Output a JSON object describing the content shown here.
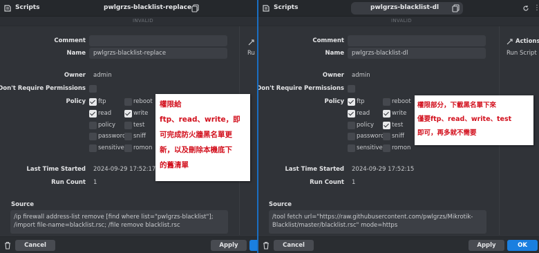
{
  "left": {
    "app_name": "Scripts",
    "title": "pwlgrzs-blacklist-replace",
    "status": "INVALID",
    "labels": {
      "comment": "Comment",
      "name": "Name",
      "owner": "Owner",
      "dont_require": "Don't Require Permissions",
      "policy": "Policy",
      "last_time_started": "Last Time Started",
      "run_count": "Run Count",
      "source": "Source"
    },
    "comment": "",
    "name": "pwlgrzs-blacklist-replace",
    "owner": "admin",
    "last_time_started": "2024-09-29 17:52:17",
    "run_count": "1",
    "policies": [
      {
        "label": "ftp",
        "checked": true
      },
      {
        "label": "reboot",
        "checked": false
      },
      {
        "label": "read",
        "checked": true
      },
      {
        "label": "write",
        "checked": true
      },
      {
        "label": "policy",
        "checked": false
      },
      {
        "label": "test",
        "checked": false
      },
      {
        "label": "password",
        "checked": false
      },
      {
        "label": "sniff",
        "checked": false
      },
      {
        "label": "sensitive",
        "checked": false
      },
      {
        "label": "romon",
        "checked": false
      }
    ],
    "source": "/ip firewall address-list remove [find where list=\"pwlgrzs-blacklist\"]; /import file-name=blacklist.rsc; /file remove blacklist.rsc",
    "side_partial": "Ru",
    "cancel": "Cancel",
    "apply": "Apply"
  },
  "right": {
    "app_name": "Scripts",
    "title": "pwlgrzs-blacklist-dl",
    "status": "INVALID",
    "labels": {
      "comment": "Comment",
      "name": "Name",
      "owner": "Owner",
      "dont_require": "Don't Require Permissions",
      "policy": "Policy",
      "last_time_started": "Last Time Started",
      "run_count": "Run Count",
      "source": "Source"
    },
    "comment": "",
    "name": "pwlgrzs-blacklist-dl",
    "owner": "admin",
    "last_time_started": "2024-09-29 17:52:15",
    "run_count": "1",
    "policies": [
      {
        "label": "ftp",
        "checked": true
      },
      {
        "label": "reboot",
        "checked": false
      },
      {
        "label": "read",
        "checked": true
      },
      {
        "label": "write",
        "checked": true
      },
      {
        "label": "policy",
        "checked": false
      },
      {
        "label": "test",
        "checked": true
      },
      {
        "label": "password",
        "checked": false
      },
      {
        "label": "sniff",
        "checked": false
      },
      {
        "label": "sensitive",
        "checked": false
      },
      {
        "label": "romon",
        "checked": false
      }
    ],
    "source": "/tool fetch url=\"https://raw.githubusercontent.com/pwlgrzs/Mikrotik-Blacklist/master/blacklist.rsc\" mode=https",
    "actions_title": "Actions",
    "run_script": "Run Script",
    "cancel": "Cancel",
    "apply": "Apply",
    "ok": "OK"
  },
  "notes": {
    "left": [
      "權限給",
      "ftp、read、write，即",
      "可完成防火牆黑名單更",
      "新，以及刪除本機底下",
      "的舊清單"
    ],
    "right": [
      "權限部分，下載黑名單下來",
      "僅要ftp、read、write、test",
      "即可，再多就不需要"
    ]
  },
  "colors": {
    "accent": "#1a7fe0",
    "note_text": "#d20f1c",
    "note_bg": "#ffffff"
  }
}
